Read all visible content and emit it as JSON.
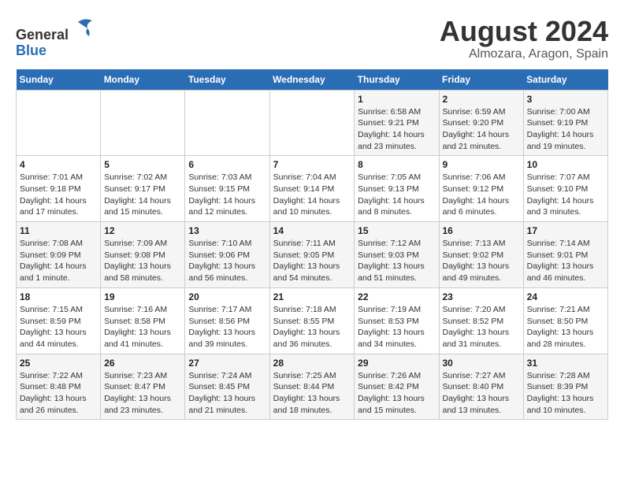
{
  "header": {
    "logo_line1": "General",
    "logo_line2": "Blue",
    "month": "August 2024",
    "location": "Almozara, Aragon, Spain"
  },
  "weekdays": [
    "Sunday",
    "Monday",
    "Tuesday",
    "Wednesday",
    "Thursday",
    "Friday",
    "Saturday"
  ],
  "weeks": [
    [
      {
        "day": "",
        "info": ""
      },
      {
        "day": "",
        "info": ""
      },
      {
        "day": "",
        "info": ""
      },
      {
        "day": "",
        "info": ""
      },
      {
        "day": "1",
        "info": "Sunrise: 6:58 AM\nSunset: 9:21 PM\nDaylight: 14 hours\nand 23 minutes."
      },
      {
        "day": "2",
        "info": "Sunrise: 6:59 AM\nSunset: 9:20 PM\nDaylight: 14 hours\nand 21 minutes."
      },
      {
        "day": "3",
        "info": "Sunrise: 7:00 AM\nSunset: 9:19 PM\nDaylight: 14 hours\nand 19 minutes."
      }
    ],
    [
      {
        "day": "4",
        "info": "Sunrise: 7:01 AM\nSunset: 9:18 PM\nDaylight: 14 hours\nand 17 minutes."
      },
      {
        "day": "5",
        "info": "Sunrise: 7:02 AM\nSunset: 9:17 PM\nDaylight: 14 hours\nand 15 minutes."
      },
      {
        "day": "6",
        "info": "Sunrise: 7:03 AM\nSunset: 9:15 PM\nDaylight: 14 hours\nand 12 minutes."
      },
      {
        "day": "7",
        "info": "Sunrise: 7:04 AM\nSunset: 9:14 PM\nDaylight: 14 hours\nand 10 minutes."
      },
      {
        "day": "8",
        "info": "Sunrise: 7:05 AM\nSunset: 9:13 PM\nDaylight: 14 hours\nand 8 minutes."
      },
      {
        "day": "9",
        "info": "Sunrise: 7:06 AM\nSunset: 9:12 PM\nDaylight: 14 hours\nand 6 minutes."
      },
      {
        "day": "10",
        "info": "Sunrise: 7:07 AM\nSunset: 9:10 PM\nDaylight: 14 hours\nand 3 minutes."
      }
    ],
    [
      {
        "day": "11",
        "info": "Sunrise: 7:08 AM\nSunset: 9:09 PM\nDaylight: 14 hours\nand 1 minute."
      },
      {
        "day": "12",
        "info": "Sunrise: 7:09 AM\nSunset: 9:08 PM\nDaylight: 13 hours\nand 58 minutes."
      },
      {
        "day": "13",
        "info": "Sunrise: 7:10 AM\nSunset: 9:06 PM\nDaylight: 13 hours\nand 56 minutes."
      },
      {
        "day": "14",
        "info": "Sunrise: 7:11 AM\nSunset: 9:05 PM\nDaylight: 13 hours\nand 54 minutes."
      },
      {
        "day": "15",
        "info": "Sunrise: 7:12 AM\nSunset: 9:03 PM\nDaylight: 13 hours\nand 51 minutes."
      },
      {
        "day": "16",
        "info": "Sunrise: 7:13 AM\nSunset: 9:02 PM\nDaylight: 13 hours\nand 49 minutes."
      },
      {
        "day": "17",
        "info": "Sunrise: 7:14 AM\nSunset: 9:01 PM\nDaylight: 13 hours\nand 46 minutes."
      }
    ],
    [
      {
        "day": "18",
        "info": "Sunrise: 7:15 AM\nSunset: 8:59 PM\nDaylight: 13 hours\nand 44 minutes."
      },
      {
        "day": "19",
        "info": "Sunrise: 7:16 AM\nSunset: 8:58 PM\nDaylight: 13 hours\nand 41 minutes."
      },
      {
        "day": "20",
        "info": "Sunrise: 7:17 AM\nSunset: 8:56 PM\nDaylight: 13 hours\nand 39 minutes."
      },
      {
        "day": "21",
        "info": "Sunrise: 7:18 AM\nSunset: 8:55 PM\nDaylight: 13 hours\nand 36 minutes."
      },
      {
        "day": "22",
        "info": "Sunrise: 7:19 AM\nSunset: 8:53 PM\nDaylight: 13 hours\nand 34 minutes."
      },
      {
        "day": "23",
        "info": "Sunrise: 7:20 AM\nSunset: 8:52 PM\nDaylight: 13 hours\nand 31 minutes."
      },
      {
        "day": "24",
        "info": "Sunrise: 7:21 AM\nSunset: 8:50 PM\nDaylight: 13 hours\nand 28 minutes."
      }
    ],
    [
      {
        "day": "25",
        "info": "Sunrise: 7:22 AM\nSunset: 8:48 PM\nDaylight: 13 hours\nand 26 minutes."
      },
      {
        "day": "26",
        "info": "Sunrise: 7:23 AM\nSunset: 8:47 PM\nDaylight: 13 hours\nand 23 minutes."
      },
      {
        "day": "27",
        "info": "Sunrise: 7:24 AM\nSunset: 8:45 PM\nDaylight: 13 hours\nand 21 minutes."
      },
      {
        "day": "28",
        "info": "Sunrise: 7:25 AM\nSunset: 8:44 PM\nDaylight: 13 hours\nand 18 minutes."
      },
      {
        "day": "29",
        "info": "Sunrise: 7:26 AM\nSunset: 8:42 PM\nDaylight: 13 hours\nand 15 minutes."
      },
      {
        "day": "30",
        "info": "Sunrise: 7:27 AM\nSunset: 8:40 PM\nDaylight: 13 hours\nand 13 minutes."
      },
      {
        "day": "31",
        "info": "Sunrise: 7:28 AM\nSunset: 8:39 PM\nDaylight: 13 hours\nand 10 minutes."
      }
    ]
  ]
}
